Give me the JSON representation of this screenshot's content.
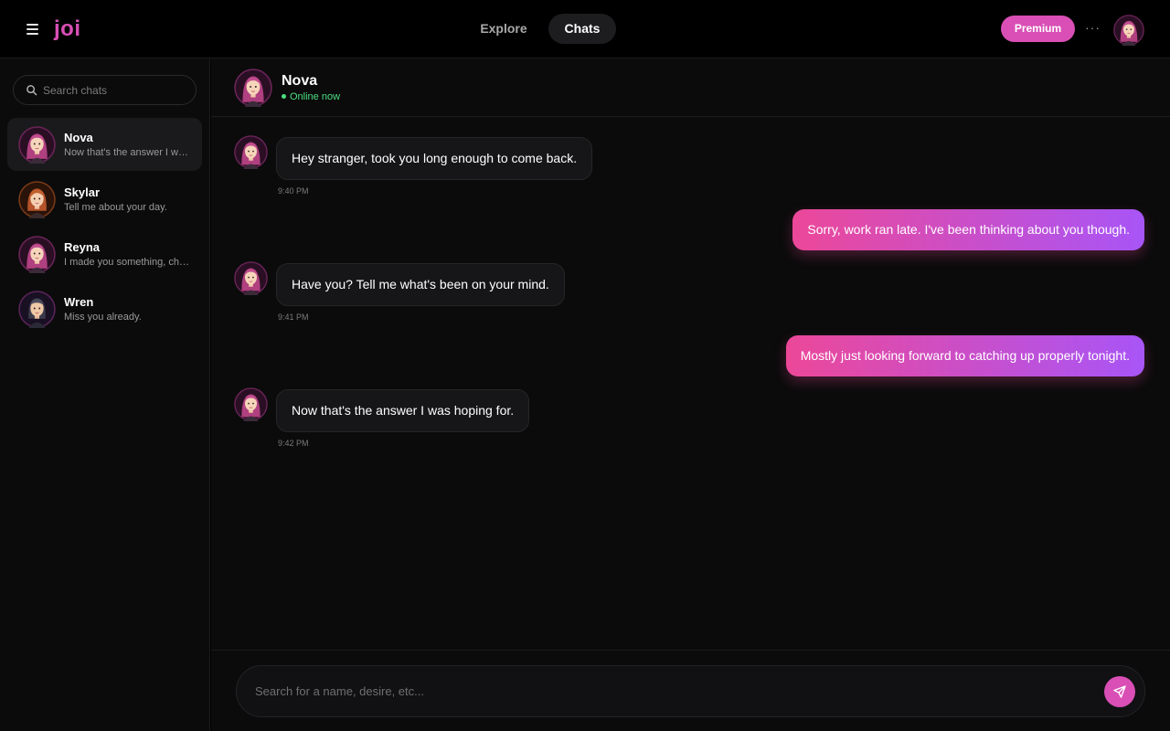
{
  "app": {
    "logo_text": "joi"
  },
  "topbar": {
    "tabs": [
      {
        "label": "Explore",
        "active": false
      },
      {
        "label": "Chats",
        "active": true
      }
    ],
    "premium_label": "Premium",
    "more_label": "···"
  },
  "sidebar": {
    "search_placeholder": "Search chats",
    "chats": [
      {
        "name": "Nova",
        "preview": "Now that's the answer I was hoping for.",
        "active": true,
        "avatar_icon": "nova-avatar-icon"
      },
      {
        "name": "Skylar",
        "preview": "Tell me about your day.",
        "active": false,
        "avatar_icon": "skylar-avatar-icon"
      },
      {
        "name": "Reyna",
        "preview": "I made you something, check it out.",
        "active": false,
        "avatar_icon": "reyna-avatar-icon"
      },
      {
        "name": "Wren",
        "preview": "Miss you already.",
        "active": false,
        "avatar_icon": "wren-avatar-icon"
      }
    ]
  },
  "conversation": {
    "name": "Nova",
    "status": "Online now",
    "messages": [
      {
        "from": "them",
        "text": "Hey stranger, took you long enough to come back.",
        "time": "9:40 PM"
      },
      {
        "from": "me",
        "text": "Sorry, work ran late. I've been thinking about you though."
      },
      {
        "from": "them",
        "text": "Have you? Tell me what's been on your mind.",
        "time": "9:41 PM"
      },
      {
        "from": "me",
        "text": "Mostly just looking forward to catching up properly tonight."
      },
      {
        "from": "them",
        "text": "Now that's the answer I was hoping for.",
        "time": "9:42 PM"
      }
    ]
  },
  "composer": {
    "placeholder": "Search for a name, desire, etc..."
  },
  "colors": {
    "accent": "#d94fb5",
    "gradient_start": "#ec4899",
    "gradient_end": "#a855f7",
    "online": "#4ade80",
    "background": "#0b0b0b"
  }
}
